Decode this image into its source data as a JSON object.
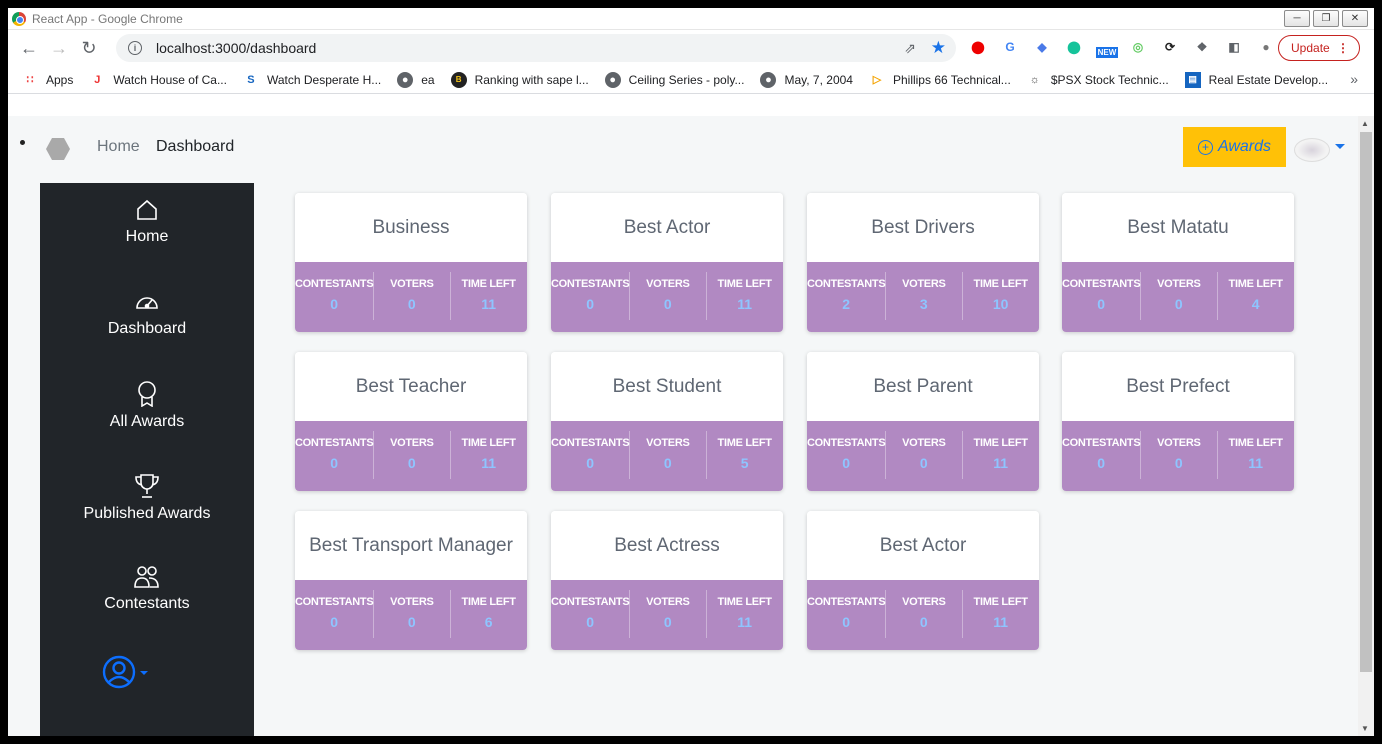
{
  "browser": {
    "window_title": "React App - Google Chrome",
    "url": "localhost:3000/dashboard",
    "update_label": "Update",
    "ext_new_badge": "NEW",
    "bookmarks": [
      {
        "label": "Apps",
        "icon": "apps-grid-icon"
      },
      {
        "label": "Watch House of Ca...",
        "icon": "tv-logo-icon"
      },
      {
        "label": "Watch Desperate H...",
        "icon": "s-logo-icon"
      },
      {
        "label": "ea",
        "icon": "globe-icon"
      },
      {
        "label": "Ranking with sape l...",
        "icon": "bw-logo-icon"
      },
      {
        "label": "Ceiling Series - poly...",
        "icon": "globe-icon"
      },
      {
        "label": "May, 7, 2004",
        "icon": "globe-icon"
      },
      {
        "label": "Phillips 66 Technical...",
        "icon": "play-icon"
      },
      {
        "label": "$PSX Stock Technic...",
        "icon": "bull-icon"
      },
      {
        "label": "Real Estate Develop...",
        "icon": "chart-icon"
      }
    ]
  },
  "topnav": {
    "home": "Home",
    "dashboard": "Dashboard",
    "awards_button": "Awards"
  },
  "sidebar": {
    "items": [
      {
        "label": "Home",
        "icon": "home-icon"
      },
      {
        "label": "Dashboard",
        "icon": "speedometer-icon"
      },
      {
        "label": "All Awards",
        "icon": "award-icon"
      },
      {
        "label": "Published Awards",
        "icon": "trophy-icon"
      },
      {
        "label": "Contestants",
        "icon": "people-icon"
      }
    ]
  },
  "stat_labels": {
    "contestants": "CONTESTANTS",
    "voters": "VOTERS",
    "time_left": "TIME LEFT"
  },
  "colors": {
    "card_stats_bg": "#b189c2",
    "stat_value": "#8ec5ff",
    "awards_button_bg": "#ffc107",
    "sidebar_bg": "#212529"
  },
  "awards": [
    {
      "title": "Business",
      "contestants": "0",
      "voters": "0",
      "time_left": "11"
    },
    {
      "title": "Best Actor",
      "contestants": "0",
      "voters": "0",
      "time_left": "11"
    },
    {
      "title": "Best Drivers",
      "contestants": "2",
      "voters": "3",
      "time_left": "10"
    },
    {
      "title": "Best Matatu",
      "contestants": "0",
      "voters": "0",
      "time_left": "4"
    },
    {
      "title": "Best Teacher",
      "contestants": "0",
      "voters": "0",
      "time_left": "11"
    },
    {
      "title": "Best Student",
      "contestants": "0",
      "voters": "0",
      "time_left": "5"
    },
    {
      "title": "Best Parent",
      "contestants": "0",
      "voters": "0",
      "time_left": "11"
    },
    {
      "title": "Best Prefect",
      "contestants": "0",
      "voters": "0",
      "time_left": "11"
    },
    {
      "title": "Best Transport Manager",
      "contestants": "0",
      "voters": "0",
      "time_left": "6"
    },
    {
      "title": "Best Actress",
      "contestants": "0",
      "voters": "0",
      "time_left": "11"
    },
    {
      "title": "Best Actor",
      "contestants": "0",
      "voters": "0",
      "time_left": "11"
    }
  ]
}
